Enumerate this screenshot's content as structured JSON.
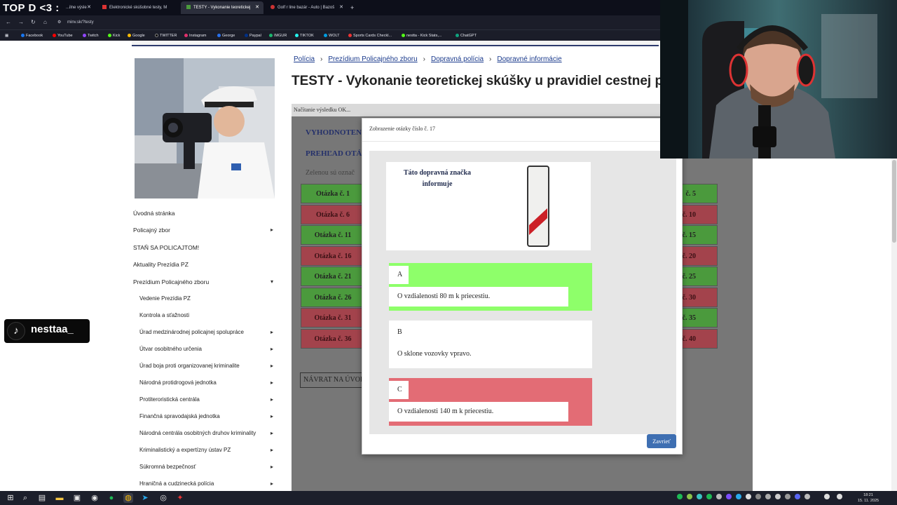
{
  "stream": {
    "title": "TOP D <3 :",
    "tiktok_handle": "nesttaa_"
  },
  "browser": {
    "tabs": [
      {
        "label": "...ilne výsle"
      },
      {
        "label": "Elektronické skúšobné testy, M"
      },
      {
        "label": "TESTY - Vykonanie teoretickej"
      },
      {
        "label": "Golf r line bazár - Auto | Bazoš"
      }
    ],
    "new_tab": "+",
    "url": "minv.sk/?testy",
    "bookmarks": [
      "Facebook",
      "YouTube",
      "Twitch",
      "Kick",
      "Google",
      "TWITTER",
      "Instagram",
      "George",
      "Paypal",
      "IMGUR",
      "TIKTOK",
      "WOLT",
      "Sports Cards Checkl...",
      "nestta - Kick Stats,...",
      "ChatGPT"
    ]
  },
  "sidebar": {
    "items": [
      {
        "label": "Úvodná stránka",
        "arrow": ""
      },
      {
        "label": "Policajný zbor",
        "arrow": "▸"
      },
      {
        "label": "STAŇ SA POLICAJTOM!",
        "arrow": ""
      },
      {
        "label": "Aktuality Prezídia PZ",
        "arrow": ""
      },
      {
        "label": "Prezídium Policajného zboru",
        "arrow": "▾"
      }
    ],
    "subitems": [
      {
        "label": "Vedenie Prezídia PZ",
        "arrow": ""
      },
      {
        "label": "Kontrola a sťažnosti",
        "arrow": ""
      },
      {
        "label": "Úrad medzinárodnej policajnej spolupráce",
        "arrow": "▸"
      },
      {
        "label": "Útvar osobitného určenia",
        "arrow": "▸"
      },
      {
        "label": "Úrad boja proti organizovanej kriminalite",
        "arrow": "▸"
      },
      {
        "label": "Národná protidrogová jednotka",
        "arrow": "▸"
      },
      {
        "label": "Protiteroristická centrála",
        "arrow": "▸"
      },
      {
        "label": "Finančná spravodajská jednotka",
        "arrow": "▸"
      },
      {
        "label": "Národná centrála osobitných druhov kriminality",
        "arrow": "▸"
      },
      {
        "label": "Kriminalistický a expertízny ústav PZ",
        "arrow": "▸"
      },
      {
        "label": "Súkromná bezpečnosť",
        "arrow": "▸"
      },
      {
        "label": "Hraničná a cudzinecká polícia",
        "arrow": "▸"
      }
    ]
  },
  "breadcrumb": [
    "Polícia",
    "Prezídium Policajného zboru",
    "Dopravná polícia",
    "Dopravné informácie"
  ],
  "page_title": "TESTY - Vykonanie teoretickej skúšky u pravidiel cestnej pre",
  "behind": {
    "status": "Načítanie výsledku OK...",
    "heading1": "VYHODNOTEN",
    "heading2": "PREHĽAD OTÁ",
    "note": "Zelenou sú označ",
    "left_cells": [
      {
        "label": "Otázka č. 1",
        "status": "g"
      },
      {
        "label": "Otázka č. 6",
        "status": "r"
      },
      {
        "label": "Otázka č. 11",
        "status": "g"
      },
      {
        "label": "Otázka č. 16",
        "status": "r"
      },
      {
        "label": "Otázka č. 21",
        "status": "g"
      },
      {
        "label": "Otázka č. 26",
        "status": "g"
      },
      {
        "label": "Otázka č. 31",
        "status": "r"
      },
      {
        "label": "Otázka č. 36",
        "status": "r"
      }
    ],
    "right_cells": [
      {
        "label": "č. 5",
        "status": "g"
      },
      {
        "label": "č. 10",
        "status": "r"
      },
      {
        "label": "č. 15",
        "status": "g"
      },
      {
        "label": "č. 20",
        "status": "r"
      },
      {
        "label": "č. 25",
        "status": "g"
      },
      {
        "label": "č. 30",
        "status": "r"
      },
      {
        "label": "č. 35",
        "status": "g"
      },
      {
        "label": "č. 40",
        "status": "r"
      }
    ],
    "back_button": "NÁVRAT NA ÚVOD"
  },
  "modal": {
    "title": "Zobrazenie otázky číslo č. 17",
    "question": "Táto dopravná značka informuje",
    "answers": [
      {
        "letter": "A",
        "text": "O vzdialenosti 80 m k priecestiu.",
        "state": "green"
      },
      {
        "letter": "B",
        "text": "O sklone vozovky vpravo.",
        "state": "neutral"
      },
      {
        "letter": "C",
        "text": "O vzdialenosti 140 m k priecestiu.",
        "state": "red"
      }
    ],
    "close_label": "Zavrieť"
  },
  "taskbar": {
    "time": "18:21",
    "date": "15. 11. 2025"
  },
  "colors": {
    "correct": "#8eff6a",
    "wrong": "#e36c75",
    "button": "#3e6fb2",
    "link": "#1a3a8c"
  }
}
